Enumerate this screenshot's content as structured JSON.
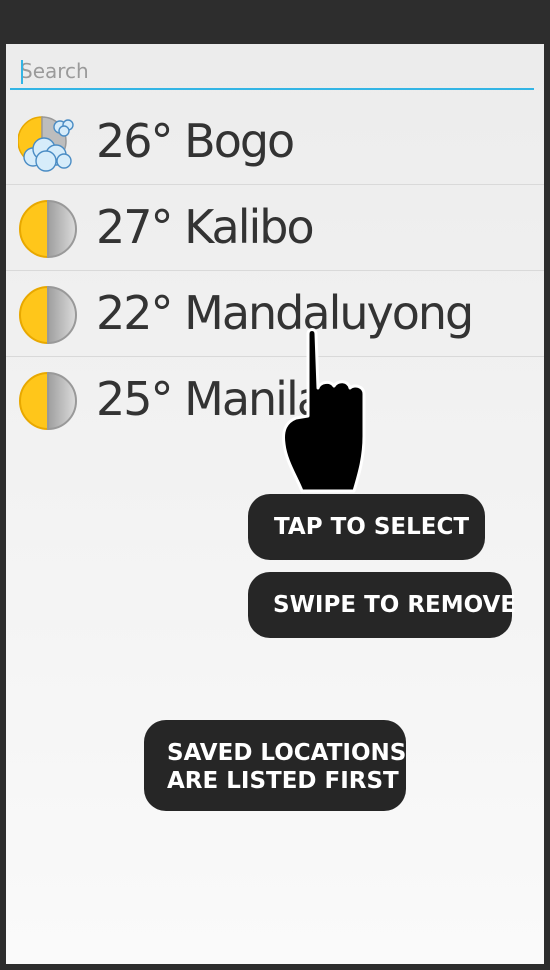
{
  "search": {
    "placeholder": "Search",
    "value": ""
  },
  "locations": [
    {
      "temp": "26°",
      "city": "Bogo",
      "label": "26° Bogo",
      "icon": "partly-cloudy-icon"
    },
    {
      "temp": "27°",
      "city": "Kalibo",
      "label": "27° Kalibo",
      "icon": "half-sun-icon"
    },
    {
      "temp": "22°",
      "city": "Mandaluyong",
      "label": "22° Mandaluyong",
      "icon": "half-sun-icon"
    },
    {
      "temp": "25°",
      "city": "Manila",
      "label": "25° Manila",
      "icon": "half-sun-icon"
    }
  ],
  "tips": {
    "tap": "TAP TO SELECT",
    "swipe": "SWIPE TO REMOVE",
    "saved_line1": "SAVED LOCATIONS",
    "saved_line2": "ARE LISTED FIRST"
  },
  "colors": {
    "accent": "#33b5e5",
    "sun": "#ffc61a",
    "sun_edge": "#e8a800",
    "tip_bg": "#262626"
  }
}
